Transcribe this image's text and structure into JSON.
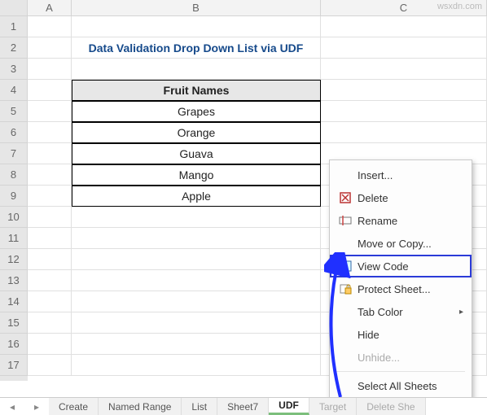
{
  "watermark": "wsxdn.com",
  "columns": [
    "A",
    "B",
    "C"
  ],
  "rows": [
    "1",
    "2",
    "3",
    "4",
    "5",
    "6",
    "7",
    "8",
    "9",
    "10",
    "11",
    "12",
    "13",
    "14",
    "15",
    "16",
    "17"
  ],
  "title": "Data Validation Drop Down List via UDF",
  "table_header": "Fruit Names",
  "fruits": [
    "Grapes",
    "Orange",
    "Guava",
    "Mango",
    "Apple"
  ],
  "tabs": {
    "items": [
      "Create",
      "Named Range",
      "List",
      "Sheet7",
      "UDF",
      "Target",
      "Delete She"
    ],
    "active": "UDF"
  },
  "menu": {
    "insert": "Insert...",
    "delete": "Delete",
    "rename": "Rename",
    "move": "Move or Copy...",
    "viewcode": "View Code",
    "protect": "Protect Sheet...",
    "tabcolor": "Tab Color",
    "hide": "Hide",
    "unhide": "Unhide...",
    "selectall": "Select All Sheets"
  }
}
